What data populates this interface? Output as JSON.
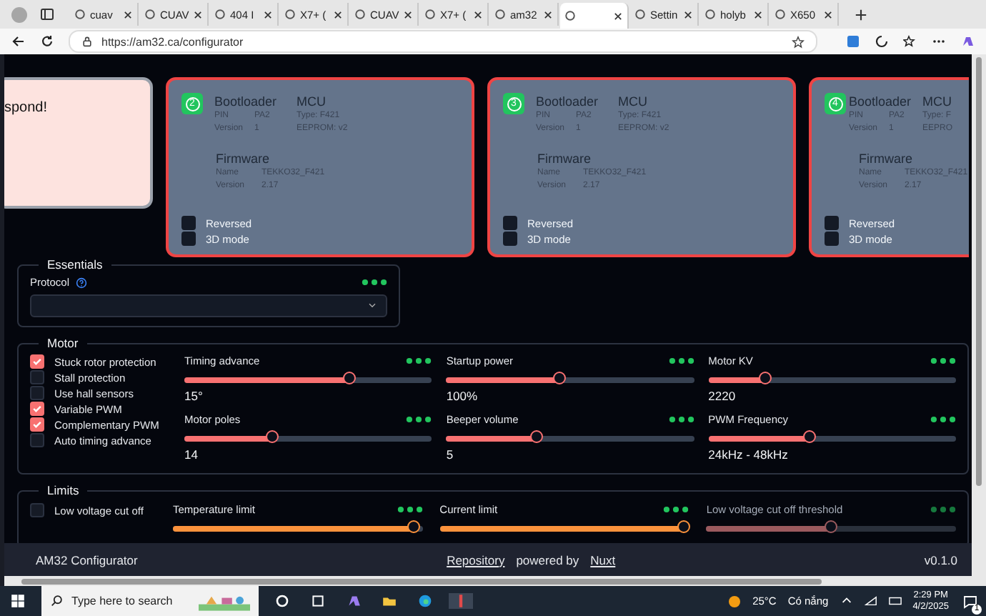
{
  "browser": {
    "tabs": [
      {
        "title": "cuav",
        "selected": false
      },
      {
        "title": "CUAV",
        "selected": false
      },
      {
        "title": "404 I",
        "selected": false
      },
      {
        "title": "X7+ (",
        "selected": false
      },
      {
        "title": "CUAV",
        "selected": false
      },
      {
        "title": "X7+ (",
        "selected": false
      },
      {
        "title": "am32",
        "selected": false
      },
      {
        "selected": true
      },
      {
        "title": "Settin",
        "selected": false
      },
      {
        "title": "holyb",
        "selected": false
      },
      {
        "title": "X650",
        "selected": false
      }
    ],
    "address": "https://am32.ca/configurator"
  },
  "notice": {
    "text": "spond!"
  },
  "escs": [
    {
      "number": "2",
      "bootloader_title": "Bootloader",
      "pin_label": "PIN",
      "pin": "PA2",
      "version_label": "Version",
      "version": "1",
      "mcu_title": "MCU",
      "mcu_type": "Type: F421",
      "eeprom": "EEPROM: v2",
      "firmware_title": "Firmware",
      "name_label": "Name",
      "name": "TEKKO32_F421",
      "fw_version_label": "Version",
      "fw_version": "2.17",
      "options": [
        {
          "label": "Reversed",
          "checked": false
        },
        {
          "label": "3D mode",
          "checked": false
        }
      ]
    },
    {
      "number": "3",
      "bootloader_title": "Bootloader",
      "pin_label": "PIN",
      "pin": "PA2",
      "version_label": "Version",
      "version": "1",
      "mcu_title": "MCU",
      "mcu_type": "Type: F421",
      "eeprom": "EEPROM: v2",
      "firmware_title": "Firmware",
      "name_label": "Name",
      "name": "TEKKO32_F421",
      "fw_version_label": "Version",
      "fw_version": "2.17",
      "options": [
        {
          "label": "Reversed",
          "checked": false
        },
        {
          "label": "3D mode",
          "checked": false
        }
      ]
    },
    {
      "number": "4",
      "bootloader_title": "Bootloader",
      "pin_label": "PIN",
      "pin": "PA2",
      "version_label": "Version",
      "version": "1",
      "mcu_title": "MCU",
      "mcu_type": "Type: F",
      "eeprom": "EEPRO",
      "firmware_title": "Firmware",
      "name_label": "Name",
      "name": "TEKKO32_F421",
      "fw_version_label": "Version",
      "fw_version": "2.17",
      "options": [
        {
          "label": "Reversed",
          "checked": false
        },
        {
          "label": "3D mode",
          "checked": false
        }
      ]
    }
  ],
  "essentials": {
    "title": "Essentials",
    "protocol_label": "Protocol"
  },
  "motor": {
    "title": "Motor",
    "options": [
      {
        "label": "Stuck rotor protection",
        "checked": true
      },
      {
        "label": "Stall protection",
        "checked": false
      },
      {
        "label": "Use hall sensors",
        "checked": false
      },
      {
        "label": "Variable PWM",
        "checked": true
      },
      {
        "label": "Complementary PWM",
        "checked": true
      },
      {
        "label": "Auto timing advance",
        "checked": false
      }
    ],
    "settings": [
      {
        "label": "Timing advance",
        "level": 0.67,
        "value": "15°"
      },
      {
        "label": "Startup power",
        "level": 0.46,
        "value": "100%"
      },
      {
        "label": "Motor KV",
        "level": 0.23,
        "value": "2220"
      },
      {
        "label": "Motor poles",
        "level": 0.36,
        "value": "14"
      },
      {
        "label": "Beeper volume",
        "level": 0.37,
        "value": "5"
      },
      {
        "label": "PWM Frequency",
        "level": 0.41,
        "value": "24kHz - 48kHz"
      }
    ]
  },
  "limits": {
    "title": "Limits",
    "options": [
      {
        "label": "Low voltage cut off",
        "checked": false
      }
    ],
    "settings": [
      {
        "label": "Temperature limit",
        "level": 0.97,
        "disabled": false
      },
      {
        "label": "Current limit",
        "level": 0.98,
        "disabled": false
      },
      {
        "label": "Low voltage cut off threshold",
        "level": 0.5,
        "disabled": true
      }
    ]
  },
  "footer": {
    "title": "AM32 Configurator",
    "repository": "Repository",
    "powered_by": "powered by",
    "nuxt": "Nuxt",
    "version": "v0.1.0"
  },
  "taskbar": {
    "search_placeholder": "Type here to search",
    "temperature": "25°C",
    "weather": "Có nắng",
    "time": "2:29 PM",
    "date": "4/2/2025",
    "notifications": "1"
  }
}
